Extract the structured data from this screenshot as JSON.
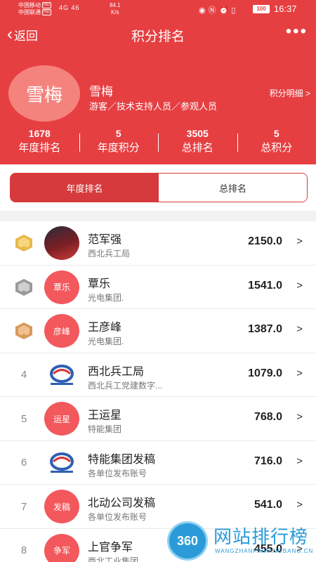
{
  "status_bar": {
    "carrier1": "中国移动",
    "carrier2": "中国联通",
    "net_badge": "HD",
    "signal": "4G 46",
    "speed_value": "84.1",
    "speed_unit": "K/s",
    "battery": "100",
    "time": "16:37"
  },
  "nav": {
    "back_label": "返回",
    "title": "积分排名",
    "more_label": "•••"
  },
  "profile": {
    "avatar_text": "雪梅",
    "name": "雪梅",
    "role": "游客／技术支持人员／参观人员",
    "points_detail": "积分明细 >",
    "stats": [
      {
        "value": "1678",
        "label": "年度排名"
      },
      {
        "value": "5",
        "label": "年度积分"
      },
      {
        "value": "3505",
        "label": "总排名"
      },
      {
        "value": "5",
        "label": "总积分"
      }
    ]
  },
  "tabs": [
    {
      "label": "年度排名",
      "active": true
    },
    {
      "label": "总排名",
      "active": false
    }
  ],
  "ranking": [
    {
      "rank": "",
      "medal": "gold-medal-icon",
      "avatar_type": "photo",
      "avatar_text": "",
      "name": "范军强",
      "org": "西北兵工局",
      "score": "2150.0",
      "arrow": ">"
    },
    {
      "rank": "",
      "medal": "silver-medal-icon",
      "avatar_type": "text",
      "avatar_text": "覃乐",
      "name": "覃乐",
      "org": "光电集团.",
      "score": "1541.0",
      "arrow": ">"
    },
    {
      "rank": "",
      "medal": "bronze-medal-icon",
      "avatar_type": "text",
      "avatar_text": "彦峰",
      "name": "王彦峰",
      "org": "光电集团.",
      "score": "1387.0",
      "arrow": ">"
    },
    {
      "rank": "4",
      "medal": "",
      "avatar_type": "logo",
      "avatar_text": "",
      "name": "西北兵工局",
      "org": "西北兵工党建数字...",
      "score": "1079.0",
      "arrow": ">"
    },
    {
      "rank": "5",
      "medal": "",
      "avatar_type": "text",
      "avatar_text": "运星",
      "name": "王运星",
      "org": "特能集团",
      "score": "768.0",
      "arrow": ">"
    },
    {
      "rank": "6",
      "medal": "",
      "avatar_type": "logo",
      "avatar_text": "",
      "name": "特能集团发稿",
      "org": "各单位发布账号",
      "score": "716.0",
      "arrow": ">"
    },
    {
      "rank": "7",
      "medal": "",
      "avatar_type": "text",
      "avatar_text": "发稿",
      "name": "北动公司发稿",
      "org": "各单位发布账号",
      "score": "541.0",
      "arrow": ">"
    },
    {
      "rank": "8",
      "medal": "",
      "avatar_type": "text",
      "avatar_text": "争军",
      "name": "上官争军",
      "org": "西北工业集团.",
      "score": "455.0",
      "arrow": ">"
    }
  ],
  "watermark": {
    "badge": "360",
    "title": "网站排行榜",
    "url": "WANGZHANPAIHANGBANG.CN"
  },
  "colors": {
    "brand_red": "#e63f42",
    "tab_red": "#d63a3c",
    "avatar_red": "#f2585c",
    "watermark_blue": "#2a9bd8"
  }
}
